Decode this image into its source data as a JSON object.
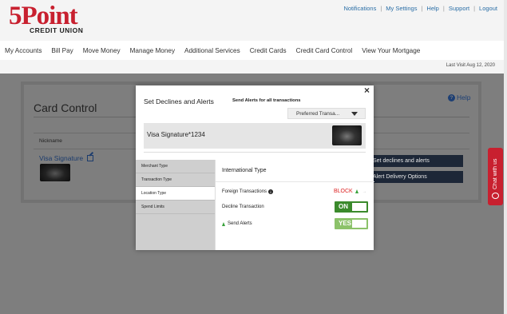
{
  "brand": {
    "logo_big": "5Point",
    "logo_small": "CREDIT UNION",
    "accent": "#c8202f"
  },
  "top_links": [
    "Notifications",
    "My Settings",
    "Help",
    "Support",
    "Logout"
  ],
  "nav": [
    "My Accounts",
    "Bill Pay",
    "Move Money",
    "Manage Money",
    "Additional Services",
    "Credit Cards",
    "Credit Card Control",
    "View Your Mortgage"
  ],
  "last_visit": "Last Visit Aug 12, 2020",
  "page": {
    "title": "Card Control",
    "help_label": "Help",
    "nickname_header": "Nickname",
    "card_nickname": "Visa Signature",
    "decline_button": "Set declines and alerts",
    "delivery_button": "Alert Delivery Options"
  },
  "chat": {
    "label": "Chat with us"
  },
  "modal": {
    "title": "Set Declines and Alerts",
    "send_all_label": "Send Alerts for all transactions",
    "preferred_value": "Preferred Transa...",
    "card_name": "Visa Signature*1234",
    "sidebar": [
      "Merchant Type",
      "Transaction Type",
      "Location Type",
      "Spend Limits"
    ],
    "active_tab": "Location Type",
    "section_title": "International Type",
    "foreign_label": "Foreign Transactions",
    "block_label": "BLOCK",
    "decline_label": "Decline Transaction",
    "decline_toggle": "ON",
    "alerts_label": "Send Alerts",
    "alerts_toggle": "YES"
  }
}
